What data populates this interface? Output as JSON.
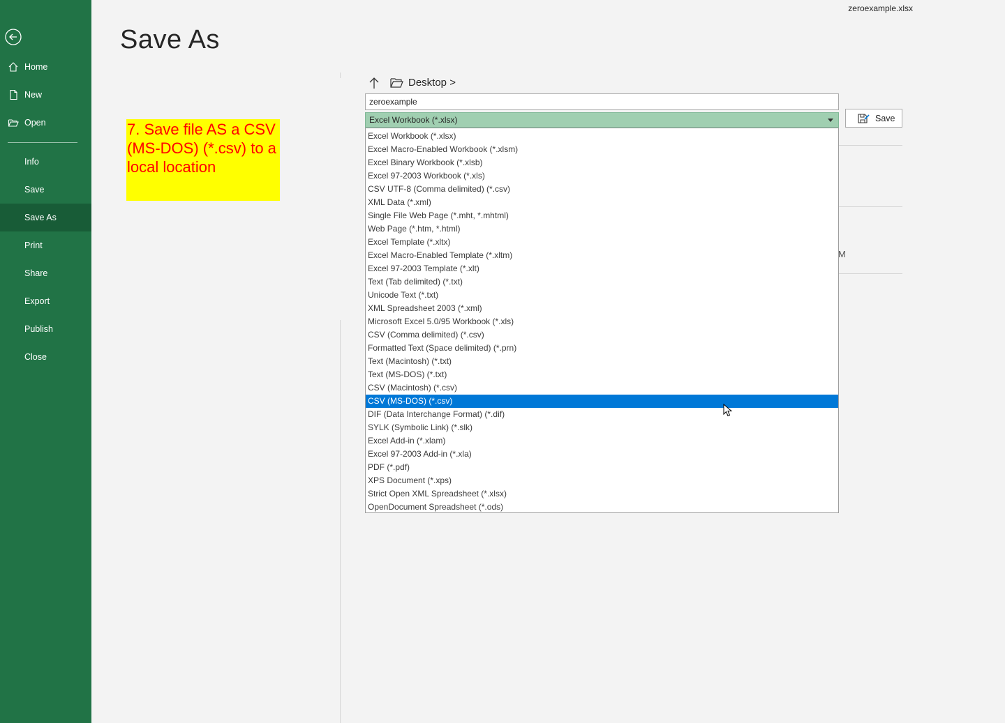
{
  "header": {
    "doc_title": "zeroexample.xlsx",
    "page_title": "Save As"
  },
  "sidebar": {
    "back_icon": "back-arrow-icon",
    "items": [
      {
        "label": "Home",
        "icon": "home-icon"
      },
      {
        "label": "New",
        "icon": "new-file-icon"
      },
      {
        "label": "Open",
        "icon": "open-folder-icon"
      },
      {
        "label": "Info"
      },
      {
        "label": "Save"
      },
      {
        "label": "Save As",
        "active": true
      },
      {
        "label": "Print"
      },
      {
        "label": "Share"
      },
      {
        "label": "Export"
      },
      {
        "label": "Publish"
      },
      {
        "label": "Close"
      }
    ]
  },
  "callout": {
    "text": "7. Save file AS a CSV (MS-DOS) (*.csv) to a local location"
  },
  "location": {
    "breadcrumb": "Desktop >"
  },
  "form": {
    "filename_value": "zeroexample",
    "filetype_selected": "Excel Workbook (*.xlsx)",
    "save_label": "Save"
  },
  "background": {
    "partial_text": "M"
  },
  "dropdown": {
    "highlighted_index": 20,
    "options": [
      "Excel Workbook (*.xlsx)",
      "Excel Macro-Enabled Workbook (*.xlsm)",
      "Excel Binary Workbook (*.xlsb)",
      "Excel 97-2003 Workbook (*.xls)",
      "CSV UTF-8 (Comma delimited) (*.csv)",
      "XML Data (*.xml)",
      "Single File Web Page (*.mht, *.mhtml)",
      "Web Page (*.htm, *.html)",
      "Excel Template (*.xltx)",
      "Excel Macro-Enabled Template (*.xltm)",
      "Excel 97-2003 Template (*.xlt)",
      "Text (Tab delimited) (*.txt)",
      "Unicode Text (*.txt)",
      "XML Spreadsheet 2003 (*.xml)",
      "Microsoft Excel 5.0/95 Workbook (*.xls)",
      "CSV (Comma delimited) (*.csv)",
      "Formatted Text (Space delimited) (*.prn)",
      "Text (Macintosh) (*.txt)",
      "Text (MS-DOS) (*.txt)",
      "CSV (Macintosh) (*.csv)",
      "CSV (MS-DOS) (*.csv)",
      "DIF (Data Interchange Format) (*.dif)",
      "SYLK (Symbolic Link) (*.slk)",
      "Excel Add-in (*.xlam)",
      "Excel 97-2003 Add-in (*.xla)",
      "PDF (*.pdf)",
      "XPS Document (*.xps)",
      "Strict Open XML Spreadsheet (*.xlsx)",
      "OpenDocument Spreadsheet (*.ods)"
    ]
  },
  "colors": {
    "sidebar_bg": "#217346",
    "sidebar_active": "#185c37",
    "filetype_bg": "#a0cfb1",
    "highlight": "#0078d7",
    "callout_bg": "#ffff00",
    "callout_text": "#ff0000"
  }
}
